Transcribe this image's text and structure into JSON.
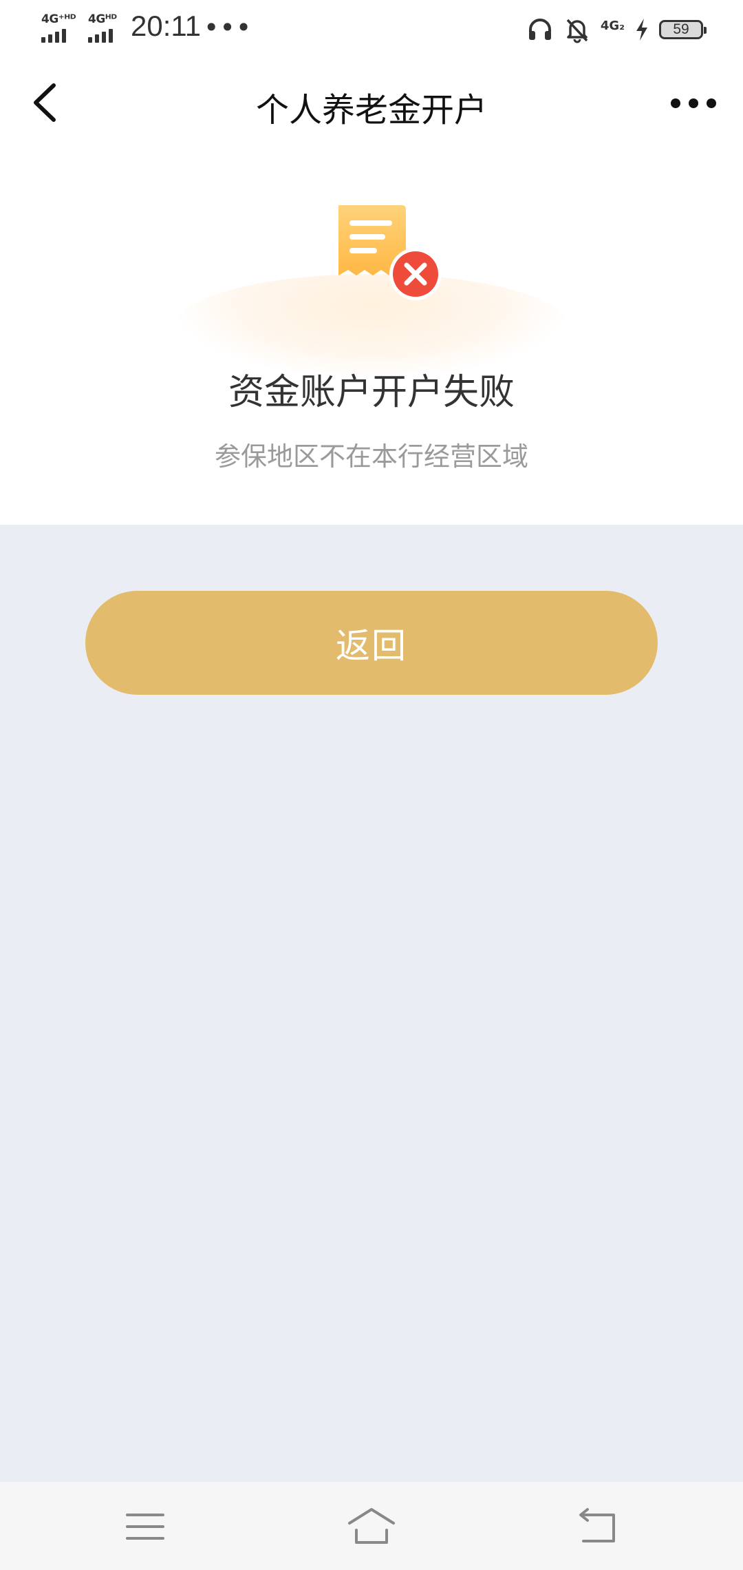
{
  "status_bar": {
    "sim1_tag": "4G⁺ᴴᴰ",
    "sim2_tag": "4Gᴴᴰ",
    "time": "20:11",
    "overflow_dots": "•••",
    "network_tag": "4G₂",
    "battery_level": "59"
  },
  "header": {
    "title": "个人养老金开户"
  },
  "result": {
    "title": "资金账户开户失败",
    "subtitle": "参保地区不在本行经营区域"
  },
  "actions": {
    "return_label": "返回"
  },
  "colors": {
    "accent": "#E2BC6C",
    "error": "#EE4B3A",
    "receipt": "#FFC85E",
    "background": "#EAEDF3"
  },
  "icons": {
    "back": "chevron-left-icon",
    "more": "more-horizontal-icon",
    "result": "receipt-failed-icon",
    "menu": "menu-icon",
    "home": "home-icon",
    "return": "return-icon"
  }
}
